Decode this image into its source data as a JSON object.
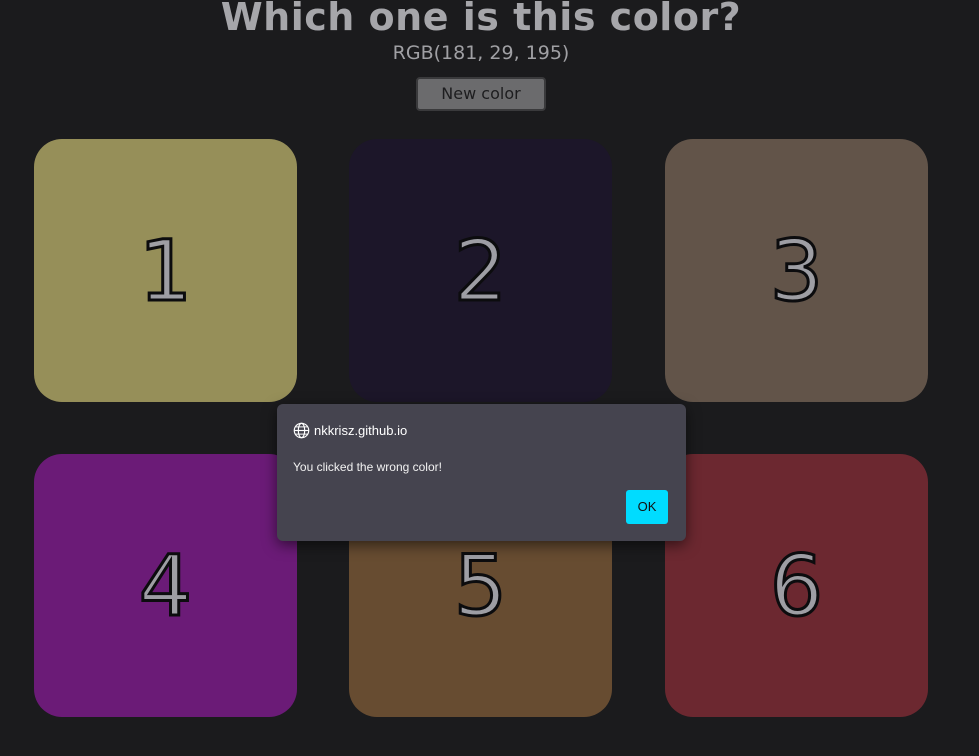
{
  "header": {
    "title": "Which one is this color?",
    "rgb_text": "RGB(181, 29, 195)",
    "new_color_label": "New color"
  },
  "tiles": [
    {
      "label": "1",
      "color": "#968f59"
    },
    {
      "label": "2",
      "color": "#1c1629"
    },
    {
      "label": "3",
      "color": "#625449"
    },
    {
      "label": "4",
      "color": "#6b1b77"
    },
    {
      "label": "5",
      "color": "#674c31"
    },
    {
      "label": "6",
      "color": "#6c2830"
    }
  ],
  "dialog": {
    "origin": "nkkrisz.github.io",
    "message": "You clicked the wrong color!",
    "ok_label": "OK",
    "ok_color": "#00dcff"
  }
}
